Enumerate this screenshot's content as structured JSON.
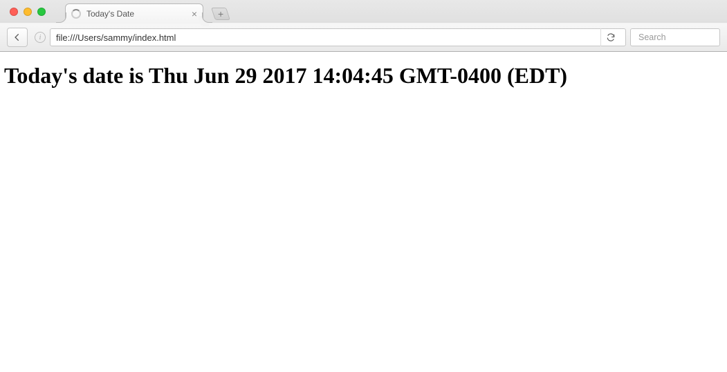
{
  "window": {
    "traffic_lights": {
      "close": "close",
      "minimize": "minimize",
      "zoom": "zoom"
    }
  },
  "tabs": {
    "active": {
      "title": "Today's Date"
    },
    "new_tab_label": "+"
  },
  "toolbar": {
    "url": "file:///Users/sammy/index.html",
    "info_label": "i",
    "search_placeholder": "Search"
  },
  "page": {
    "heading": "Today's date is Thu Jun 29 2017 14:04:45 GMT-0400 (EDT)"
  }
}
